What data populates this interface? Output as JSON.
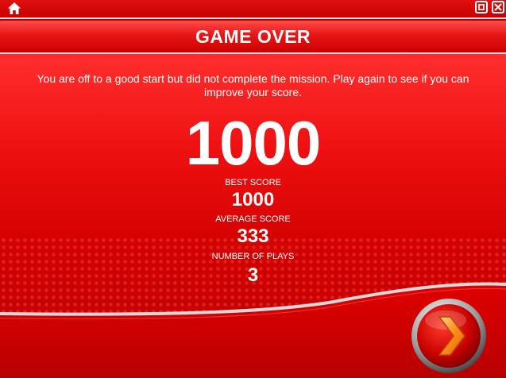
{
  "header": {
    "title": "GAME OVER"
  },
  "toolbar": {
    "home_icon": "home-icon",
    "restore_icon": "restore-icon",
    "close_icon": "close-icon"
  },
  "main": {
    "message": "You are off to a good start but did not complete the mission. Play again to see if you can improve your score.",
    "score": "1000",
    "stats": [
      {
        "label": "BEST SCORE",
        "value": "1000"
      },
      {
        "label": "AVERAGE SCORE",
        "value": "333"
      },
      {
        "label": "NUMBER OF PLAYS",
        "value": "3"
      }
    ]
  },
  "next_button": {
    "icon": "chevron-right-icon"
  },
  "colors": {
    "primary_red": "#e00000",
    "chevron_orange": "#ff8c1a",
    "separator": "#d8d8d8"
  }
}
